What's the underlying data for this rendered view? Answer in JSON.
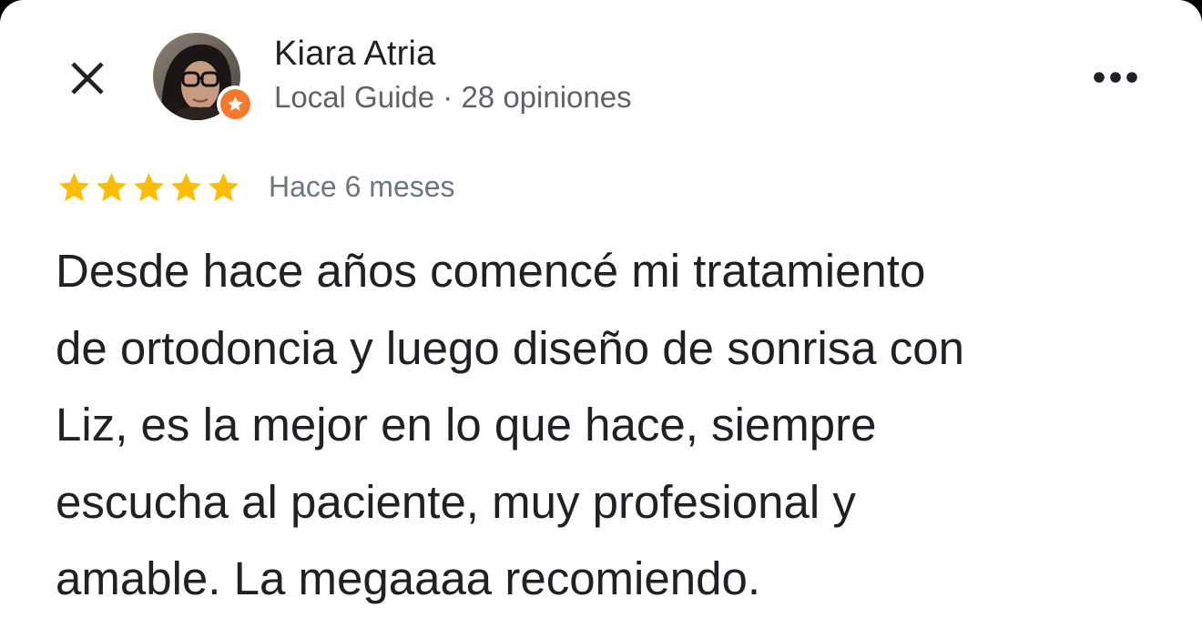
{
  "header": {
    "close_icon": "close-icon",
    "more_icon": "more-horizontal-icon"
  },
  "author": {
    "name": "Kiara Atria",
    "meta": "Local Guide · 28 opiniones",
    "avatar_icon": "user-avatar",
    "badge_icon": "local-guide-star-icon",
    "badge_color": "#f4792a"
  },
  "review": {
    "rating": 5,
    "max_rating": 5,
    "star_color": "#fbbc04",
    "time": "Hace 6 meses",
    "lines": [
      "Desde hace años comencé mi tratamiento",
      "de ortodoncia y luego diseño de sonrisa con",
      "Liz, es la mejor en lo que hace, siempre",
      "escucha al paciente, muy profesional y",
      "amable. La megaaaa recomiendo."
    ]
  }
}
